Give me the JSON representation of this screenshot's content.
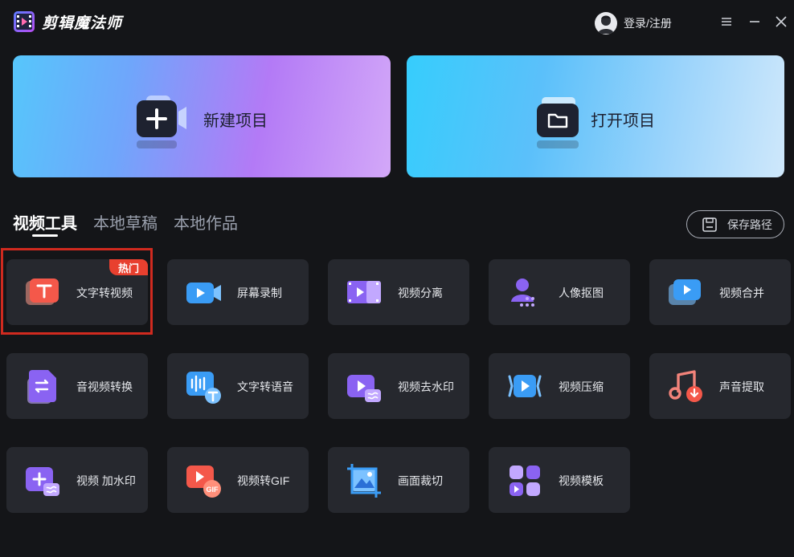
{
  "app": {
    "title": "剪辑魔法师",
    "logo_icon": "film-logo-icon"
  },
  "header": {
    "login_label": "登录/注册",
    "menu_icon": "menu-icon",
    "minimize_icon": "minimize-icon",
    "close_icon": "close-icon"
  },
  "hero": {
    "new_project": {
      "label": "新建项目",
      "icon": "camera-plus-icon"
    },
    "open_project": {
      "label": "打开项目",
      "icon": "folder-open-icon"
    }
  },
  "tabs": [
    {
      "label": "视频工具",
      "active": true
    },
    {
      "label": "本地草稿",
      "active": false
    },
    {
      "label": "本地作品",
      "active": false
    }
  ],
  "save_path": {
    "label": "保存路径",
    "icon": "save-icon"
  },
  "tools": [
    {
      "label": "文字转视频",
      "icon": "text-to-video-icon",
      "badge": "热门"
    },
    {
      "label": "屏幕录制",
      "icon": "screen-record-icon"
    },
    {
      "label": "视频分离",
      "icon": "video-split-icon"
    },
    {
      "label": "人像抠图",
      "icon": "portrait-cutout-icon"
    },
    {
      "label": "视频合并",
      "icon": "video-merge-icon"
    },
    {
      "label": "音视频转换",
      "icon": "av-convert-icon"
    },
    {
      "label": "文字转语音",
      "icon": "text-to-speech-icon"
    },
    {
      "label": "视频去水印",
      "icon": "remove-watermark-icon"
    },
    {
      "label": "视频压缩",
      "icon": "video-compress-icon"
    },
    {
      "label": "声音提取",
      "icon": "audio-extract-icon"
    },
    {
      "label": "视频 加水印",
      "icon": "add-watermark-icon"
    },
    {
      "label": "视频转GIF",
      "icon": "video-to-gif-icon"
    },
    {
      "label": "画面裁切",
      "icon": "crop-icon"
    },
    {
      "label": "视频模板",
      "icon": "video-template-icon"
    }
  ],
  "colors": {
    "background": "#141518",
    "card": "#26282e",
    "hot_badge": "#e8402f",
    "highlight_border": "#d02a1f"
  }
}
